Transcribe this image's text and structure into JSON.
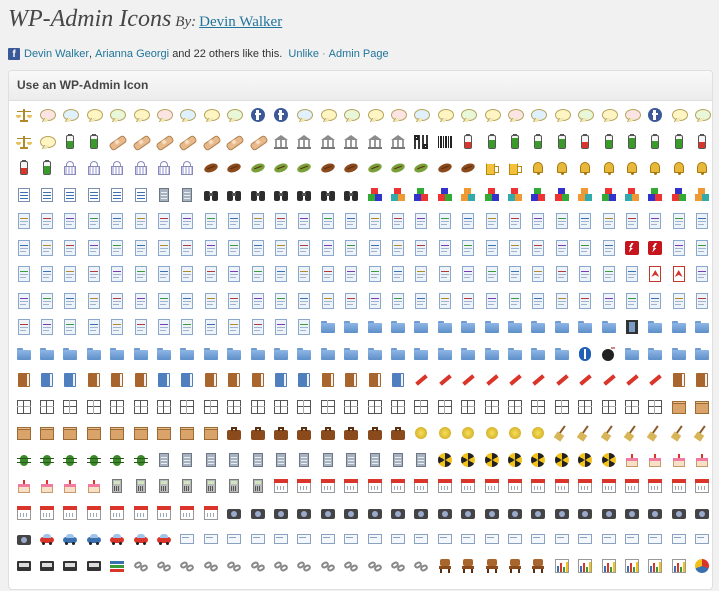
{
  "header": {
    "title": "WP-Admin Icons",
    "by_label": "By:",
    "author_link": "Devin Walker"
  },
  "like_bar": {
    "fb_glyph": "f",
    "name_1": "Devin Walker",
    "comma": ",",
    "name_2": "Arianna Georgi",
    "suffix": "and 22 others like this.",
    "unlike": "Unlike",
    "separator": "·",
    "admin_page": "Admin Page"
  },
  "panel": {
    "title": "Use an WP-Admin Icon"
  },
  "icon_rows": [
    [
      "scales",
      "chat-bubble",
      "chat-bubble",
      "chat-bubble",
      "chat-bubble",
      "chat-bubble",
      "chat-bubble",
      "chat-bubble",
      "chat-bubble",
      "chat-bubble",
      "facebook",
      "facebook",
      "chat-bubble",
      "chat-bubble",
      "chat-bubble",
      "chat-bubble",
      "chat-bubble",
      "chat-bubble",
      "chat-bubble",
      "chat-bubble",
      "chat-bubble",
      "chat-bubble",
      "chat-bubble",
      "chat-bubble",
      "chat-bubble",
      "chat-bubble",
      "chat-bubble",
      "facebook",
      "chat-bubble",
      "chat-bubble"
    ],
    [
      "scales",
      "chat-bubble",
      "battery",
      "battery",
      "bandaid",
      "bandaid",
      "bandaid",
      "bandaid",
      "bandaid",
      "bandaid",
      "bandaid",
      "bank",
      "bank",
      "bank",
      "bank",
      "bank",
      "bank",
      "qr-code",
      "barcode",
      "battery",
      "battery",
      "battery",
      "battery",
      "battery",
      "battery",
      "battery",
      "battery",
      "battery",
      "battery",
      "battery"
    ],
    [
      "battery",
      "battery",
      "basket",
      "basket",
      "basket",
      "basket",
      "basket",
      "basket",
      "bean",
      "bean",
      "bean",
      "bean",
      "bean",
      "bean",
      "bean",
      "bean",
      "bean",
      "bean",
      "bean",
      "bean",
      "beer",
      "beer",
      "bell",
      "bell",
      "bell",
      "bell",
      "bell",
      "bell",
      "bell",
      "bell"
    ],
    [
      "binary",
      "binary",
      "binary",
      "binary",
      "binary",
      "binary",
      "building",
      "building",
      "binoculars",
      "binoculars",
      "binoculars",
      "binoculars",
      "binoculars",
      "binoculars",
      "binoculars",
      "blocks",
      "blocks",
      "blocks",
      "blocks",
      "blocks",
      "blocks",
      "blocks",
      "blocks",
      "blocks",
      "blocks",
      "blocks",
      "blocks",
      "blocks",
      "blocks",
      "blocks"
    ],
    [
      "document",
      "document",
      "document",
      "document",
      "document",
      "document",
      "document",
      "document",
      "document",
      "document",
      "document",
      "document",
      "document",
      "document",
      "document",
      "document",
      "document",
      "document",
      "document",
      "document",
      "document",
      "document",
      "document",
      "document",
      "document",
      "document",
      "document",
      "document",
      "document",
      "document"
    ],
    [
      "document",
      "document",
      "document",
      "document",
      "document",
      "document",
      "document",
      "document",
      "document",
      "document",
      "document",
      "document",
      "document",
      "document",
      "document",
      "document",
      "document",
      "document",
      "document",
      "document",
      "document",
      "document",
      "document",
      "document",
      "document",
      "document",
      "flash",
      "flash",
      "document",
      "document"
    ],
    [
      "document",
      "document",
      "document",
      "document",
      "document",
      "document",
      "document",
      "document",
      "document",
      "document",
      "document",
      "document",
      "document",
      "document",
      "document",
      "document",
      "document",
      "document",
      "document",
      "document",
      "document",
      "document",
      "document",
      "document",
      "document",
      "document",
      "document",
      "acrobat",
      "acrobat",
      "document"
    ],
    [
      "document",
      "document",
      "document",
      "document",
      "document",
      "document",
      "document",
      "document",
      "document",
      "document",
      "document",
      "document",
      "document",
      "document",
      "document",
      "document",
      "document",
      "document",
      "document",
      "document",
      "document",
      "document",
      "document",
      "document",
      "document",
      "document",
      "document",
      "document",
      "document",
      "document"
    ],
    [
      "document",
      "document",
      "document",
      "document",
      "document",
      "document",
      "document",
      "document",
      "document",
      "document",
      "document",
      "document",
      "document",
      "folder",
      "folder",
      "folder",
      "folder",
      "folder",
      "folder",
      "folder",
      "folder",
      "folder",
      "folder",
      "folder",
      "folder",
      "folder",
      "film",
      "folder",
      "folder",
      "folder"
    ],
    [
      "folder",
      "folder",
      "folder",
      "folder",
      "folder",
      "folder",
      "folder",
      "folder",
      "folder",
      "folder",
      "folder",
      "folder",
      "folder",
      "folder",
      "folder",
      "folder",
      "folder",
      "folder",
      "folder",
      "folder",
      "folder",
      "folder",
      "folder",
      "folder",
      "bluetooth",
      "bomb",
      "folder",
      "folder",
      "folder",
      "folder"
    ],
    [
      "book",
      "book",
      "book",
      "book",
      "book",
      "book",
      "book",
      "book",
      "book",
      "book",
      "book",
      "book",
      "book",
      "book",
      "book",
      "book",
      "book",
      "bookmark",
      "bookmark",
      "bookmark",
      "bookmark",
      "bookmark",
      "bookmark",
      "bookmark",
      "bookmark",
      "bookmark",
      "bookmark",
      "bookmark",
      "book",
      "book"
    ],
    [
      "table",
      "table",
      "table",
      "table",
      "table",
      "table",
      "table",
      "table",
      "table",
      "table",
      "table",
      "table",
      "table",
      "table",
      "table",
      "table",
      "table",
      "table",
      "table",
      "table",
      "table",
      "table",
      "table",
      "table",
      "table",
      "table",
      "table",
      "table",
      "box",
      "box"
    ],
    [
      "box",
      "box",
      "box",
      "box",
      "box",
      "box",
      "box",
      "box",
      "box",
      "briefcase",
      "briefcase",
      "briefcase",
      "briefcase",
      "briefcase",
      "briefcase",
      "briefcase",
      "briefcase",
      "coin",
      "coin",
      "coin",
      "coin",
      "coin",
      "coin",
      "broom",
      "broom",
      "broom",
      "broom",
      "broom",
      "broom",
      "broom"
    ],
    [
      "bug",
      "bug",
      "bug",
      "bug",
      "bug",
      "bug",
      "building",
      "building",
      "building",
      "building",
      "building",
      "building",
      "building",
      "building",
      "building",
      "building",
      "building",
      "building",
      "radiation",
      "radiation",
      "radiation",
      "radiation",
      "radiation",
      "radiation",
      "radiation",
      "radiation",
      "cake",
      "cake",
      "cake",
      "cake"
    ],
    [
      "cake",
      "cake",
      "cake",
      "cake",
      "calculator",
      "calculator",
      "calculator",
      "calculator",
      "calculator",
      "calculator",
      "calculator",
      "calendar",
      "calendar",
      "calendar",
      "calendar",
      "calendar",
      "calendar",
      "calendar",
      "calendar",
      "calendar",
      "calendar",
      "calendar",
      "calendar",
      "calendar",
      "calendar",
      "calendar",
      "calendar",
      "calendar",
      "calendar",
      "calendar"
    ],
    [
      "calendar",
      "calendar",
      "calendar",
      "calendar",
      "calendar",
      "calendar",
      "calendar",
      "calendar",
      "calendar",
      "camera",
      "camera",
      "camera",
      "camera",
      "camera",
      "camera",
      "camera",
      "camera",
      "camera",
      "camera",
      "camera",
      "camera",
      "camera",
      "camera",
      "camera",
      "camera",
      "camera",
      "camera",
      "camera",
      "camera",
      "camera"
    ],
    [
      "camera",
      "car",
      "car",
      "car",
      "car",
      "car",
      "car",
      "card",
      "card",
      "card",
      "card",
      "card",
      "card",
      "card",
      "card",
      "card",
      "card",
      "card",
      "card",
      "card",
      "card",
      "card",
      "card",
      "card",
      "card",
      "card",
      "card",
      "card",
      "card",
      "card"
    ],
    [
      "cassette",
      "cassette",
      "cassette",
      "cassette",
      "stack",
      "chain",
      "chain",
      "chain",
      "chain",
      "chain",
      "chain",
      "chain",
      "chain",
      "chain",
      "chain",
      "chain",
      "chain",
      "chain",
      "chair",
      "chair",
      "chair",
      "chair",
      "chair",
      "chart",
      "chart",
      "chart",
      "chart",
      "chart",
      "chart",
      "pie-chart"
    ]
  ]
}
